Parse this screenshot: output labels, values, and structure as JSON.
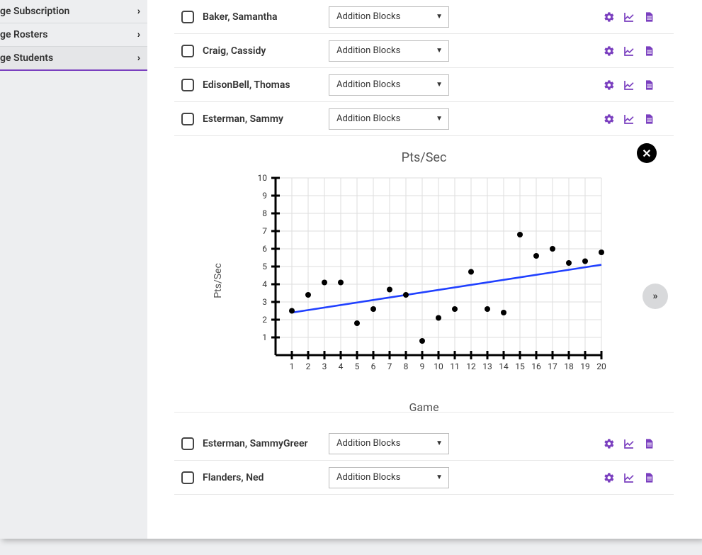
{
  "sidebar": {
    "items": [
      {
        "label": "ge Subscription"
      },
      {
        "label": "ge Rosters"
      },
      {
        "label": "ge Students"
      }
    ]
  },
  "dropdown_label": "Addition Blocks",
  "students": [
    {
      "name": "Baker, Samantha"
    },
    {
      "name": "Craig, Cassidy"
    },
    {
      "name": "EdisonBell, Thomas"
    },
    {
      "name": "Esterman, Sammy"
    }
  ],
  "students_below": [
    {
      "name": "Esterman, SammyGreer"
    },
    {
      "name": "Flanders, Ned"
    }
  ],
  "chart_data": {
    "type": "scatter",
    "title": "Pts/Sec",
    "xlabel": "Game",
    "ylabel": "Pts/Sec",
    "x": [
      1,
      2,
      3,
      4,
      5,
      6,
      7,
      8,
      9,
      10,
      11,
      12,
      13,
      14,
      15,
      16,
      17,
      18,
      19,
      20
    ],
    "y": [
      2.5,
      3.4,
      4.1,
      4.1,
      1.8,
      2.6,
      3.7,
      3.4,
      0.8,
      2.1,
      2.6,
      4.7,
      2.6,
      2.4,
      6.8,
      5.6,
      6.0,
      5.2,
      5.3,
      5.8
    ],
    "xtick_labels": [
      "1",
      "2",
      "3",
      "4",
      "5",
      "6",
      "7",
      "8",
      "9",
      "10",
      "11",
      "12",
      "13",
      "14",
      "15",
      "16",
      "17",
      "18",
      "19",
      "20"
    ],
    "ytick_labels": [
      "1",
      "2",
      "3",
      "4",
      "5",
      "6",
      "7",
      "8",
      "9",
      "10"
    ],
    "xlim": [
      0,
      20
    ],
    "ylim": [
      0,
      10
    ],
    "trend": {
      "x1": 1,
      "y1": 2.4,
      "x2": 20,
      "y2": 5.1
    }
  }
}
